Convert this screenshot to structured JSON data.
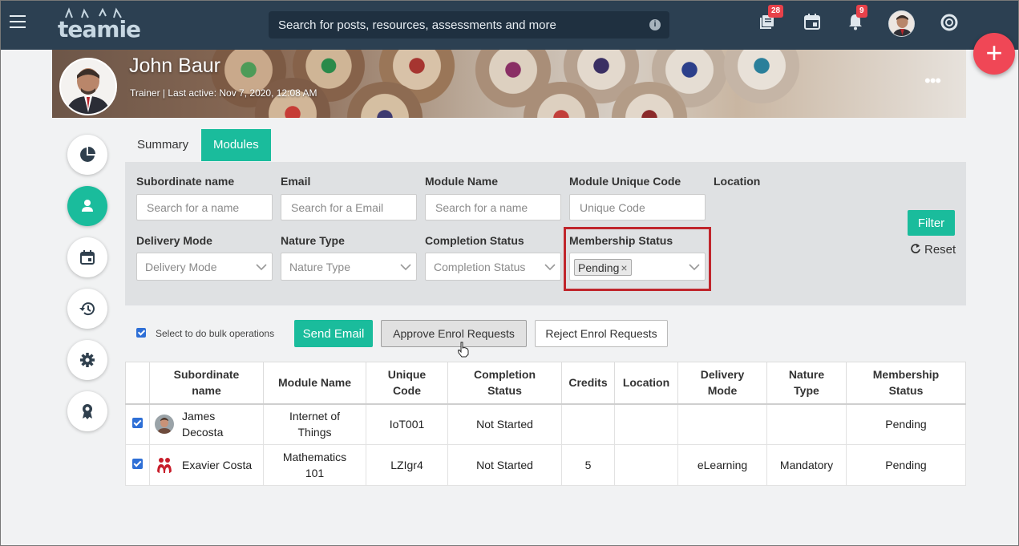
{
  "app": {
    "logo_text": "teamie"
  },
  "search": {
    "placeholder": "Search for posts, resources, assessments and more"
  },
  "nav": {
    "posts_badge": "28",
    "notifications_badge": "9"
  },
  "fab": {
    "label": "+"
  },
  "profile": {
    "name": "John Baur",
    "subtitle": "Trainer | Last active: Nov 7, 2020, 12:08 AM",
    "more_label": "•••"
  },
  "tabs": {
    "summary": "Summary",
    "modules": "Modules"
  },
  "filters": {
    "subordinate_label": "Subordinate name",
    "subordinate_placeholder": "Search for a name",
    "email_label": "Email",
    "email_placeholder": "Search for a Email",
    "module_name_label": "Module Name",
    "module_name_placeholder": "Search for a name",
    "unique_code_label": "Module Unique Code",
    "unique_code_placeholder": "Unique Code",
    "location_label": "Location",
    "delivery_label": "Delivery Mode",
    "delivery_placeholder": "Delivery Mode",
    "nature_label": "Nature Type",
    "nature_placeholder": "Nature Type",
    "completion_label": "Completion Status",
    "completion_placeholder": "Completion Status",
    "membership_label": "Membership Status",
    "membership_selected": "Pending",
    "filter_button": "Filter",
    "reset_label": "Reset"
  },
  "bulk": {
    "select_label": "Select to do bulk operations",
    "send_email": "Send Email",
    "approve": "Approve Enrol Requests",
    "reject": "Reject Enrol Requests"
  },
  "table": {
    "headers": {
      "subordinate_1": "Subordinate",
      "subordinate_2": "name",
      "module_name": "Module Name",
      "unique_1": "Unique",
      "unique_2": "Code",
      "completion_1": "Completion",
      "completion_2": "Status",
      "credits": "Credits",
      "location": "Location",
      "delivery_1": "Delivery",
      "delivery_2": "Mode",
      "nature_1": "Nature",
      "nature_2": "Type",
      "membership_1": "Membership",
      "membership_2": "Status"
    },
    "rows": [
      {
        "name_1": "James",
        "name_2": "Decosta",
        "module_1": "Internet of",
        "module_2": "Things",
        "code": "IoT001",
        "completion": "Not Started",
        "credits": "",
        "location": "",
        "delivery": "",
        "nature": "",
        "membership": "Pending"
      },
      {
        "name_1": "Exavier Costa",
        "module_1": "Mathematics",
        "module_2": "101",
        "code": "LZIgr4",
        "completion": "Not Started",
        "credits": "5",
        "location": "",
        "delivery": "eLearning",
        "nature": "Mandatory",
        "membership": "Pending"
      }
    ]
  },
  "colors": {
    "accent": "#1abc9c",
    "nav_bg": "#2c4052",
    "fab": "#f04756",
    "highlight": "#c0262c"
  }
}
